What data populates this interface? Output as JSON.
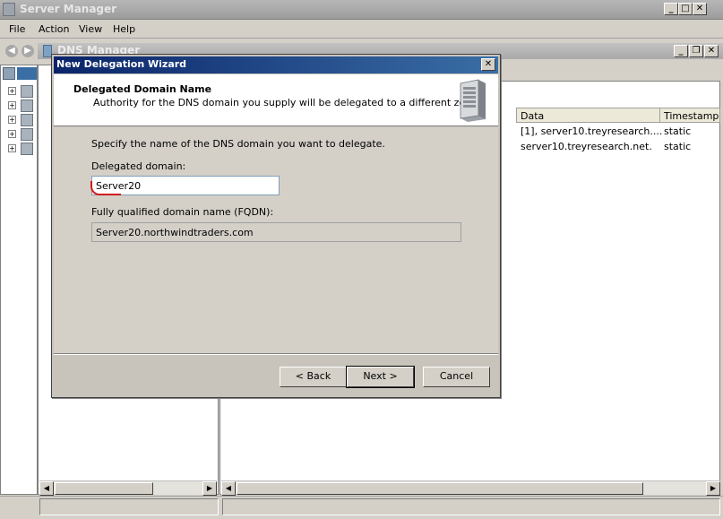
{
  "server_manager": {
    "title": "Server Manager",
    "menu": [
      "File",
      "Action",
      "View",
      "Help"
    ]
  },
  "dns_manager": {
    "title": "DNS Manager",
    "columns": [
      "Data",
      "Timestamp"
    ],
    "rows": [
      {
        "data": "[1], server10.treyresearch....",
        "timestamp": "static"
      },
      {
        "data": "server10.treyresearch.net.",
        "timestamp": "static"
      }
    ]
  },
  "wizard": {
    "title": "New Delegation Wizard",
    "heading": "Delegated Domain Name",
    "subheading": "Authority for the DNS domain you supply will be delegated to a different zone.",
    "instruction": "Specify the name of the DNS domain you want to delegate.",
    "delegated_domain_label": "Delegated domain:",
    "delegated_domain_value": "Server20",
    "fqdn_label": "Fully qualified domain name (FQDN):",
    "fqdn_value": "Server20.northwindtraders.com",
    "buttons": {
      "back": "< Back",
      "next": "Next >",
      "cancel": "Cancel"
    }
  },
  "icons": {
    "close": "✕",
    "minimize": "_",
    "maximize": "□",
    "restore": "❐"
  },
  "colors": {
    "wizard_title_start": "#0a246a",
    "wizard_title_end": "#3a6ea5",
    "annotation_red": "#d01c1c"
  }
}
